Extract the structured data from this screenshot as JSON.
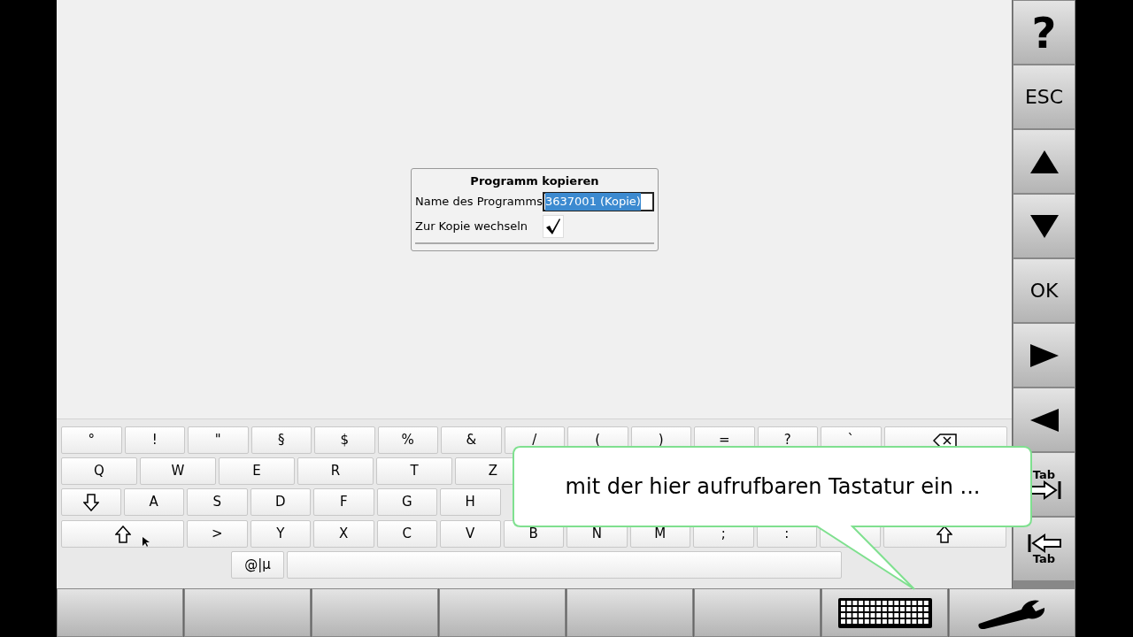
{
  "dialog": {
    "title": "Programm kopieren",
    "fields": [
      {
        "kind": "text",
        "label": "Name des Programms",
        "value": "3637001 (Kopie)",
        "selected": true
      },
      {
        "kind": "checkbox",
        "label": "Zur Kopie wechseln",
        "checked": true
      }
    ]
  },
  "keyboard": {
    "rows": [
      {
        "keys": [
          {
            "label": "°"
          },
          {
            "label": "!"
          },
          {
            "label": "\""
          },
          {
            "label": "§"
          },
          {
            "label": "$"
          },
          {
            "label": "%"
          },
          {
            "label": "&"
          },
          {
            "label": "/"
          },
          {
            "label": "("
          },
          {
            "label": ")"
          },
          {
            "label": "="
          },
          {
            "label": "?"
          },
          {
            "label": "`"
          },
          {
            "kind": "backspace"
          }
        ]
      },
      {
        "keys": [
          {
            "label": "Q"
          },
          {
            "label": "W"
          },
          {
            "label": "E"
          },
          {
            "label": "R"
          },
          {
            "label": "T"
          },
          {
            "label": "Z"
          }
        ]
      },
      {
        "keys": [
          {
            "kind": "caps"
          },
          {
            "label": "A"
          },
          {
            "label": "S"
          },
          {
            "label": "D"
          },
          {
            "label": "F"
          },
          {
            "label": "G"
          },
          {
            "label": "H"
          }
        ]
      },
      {
        "keys": [
          {
            "kind": "shift"
          },
          {
            "label": ">"
          },
          {
            "label": "Y"
          },
          {
            "label": "X"
          },
          {
            "label": "C"
          },
          {
            "label": "V"
          },
          {
            "label": "B"
          },
          {
            "label": "N"
          },
          {
            "label": "M"
          },
          {
            "label": ";"
          },
          {
            "label": ":"
          },
          {
            "kind": "blank"
          },
          {
            "kind": "shift"
          }
        ]
      },
      {
        "keys": [
          {
            "label": "@|µ"
          },
          {
            "kind": "space"
          }
        ]
      }
    ]
  },
  "callout": {
    "text": "mit der hier aufrufbaren Tastatur ein ..."
  },
  "side_buttons": [
    {
      "kind": "text",
      "label": "?"
    },
    {
      "kind": "text",
      "label": "ESC"
    },
    {
      "kind": "up"
    },
    {
      "kind": "down"
    },
    {
      "kind": "text",
      "label": "OK"
    },
    {
      "kind": "right"
    },
    {
      "kind": "left"
    },
    {
      "kind": "tab-forward",
      "label": "Tab"
    },
    {
      "kind": "tab-back",
      "label": "Tab"
    }
  ],
  "bottom_buttons": [
    {
      "kind": "blank"
    },
    {
      "kind": "blank"
    },
    {
      "kind": "blank"
    },
    {
      "kind": "blank"
    },
    {
      "kind": "blank"
    },
    {
      "kind": "blank"
    },
    {
      "kind": "keyboard"
    },
    {
      "kind": "wrench"
    }
  ]
}
